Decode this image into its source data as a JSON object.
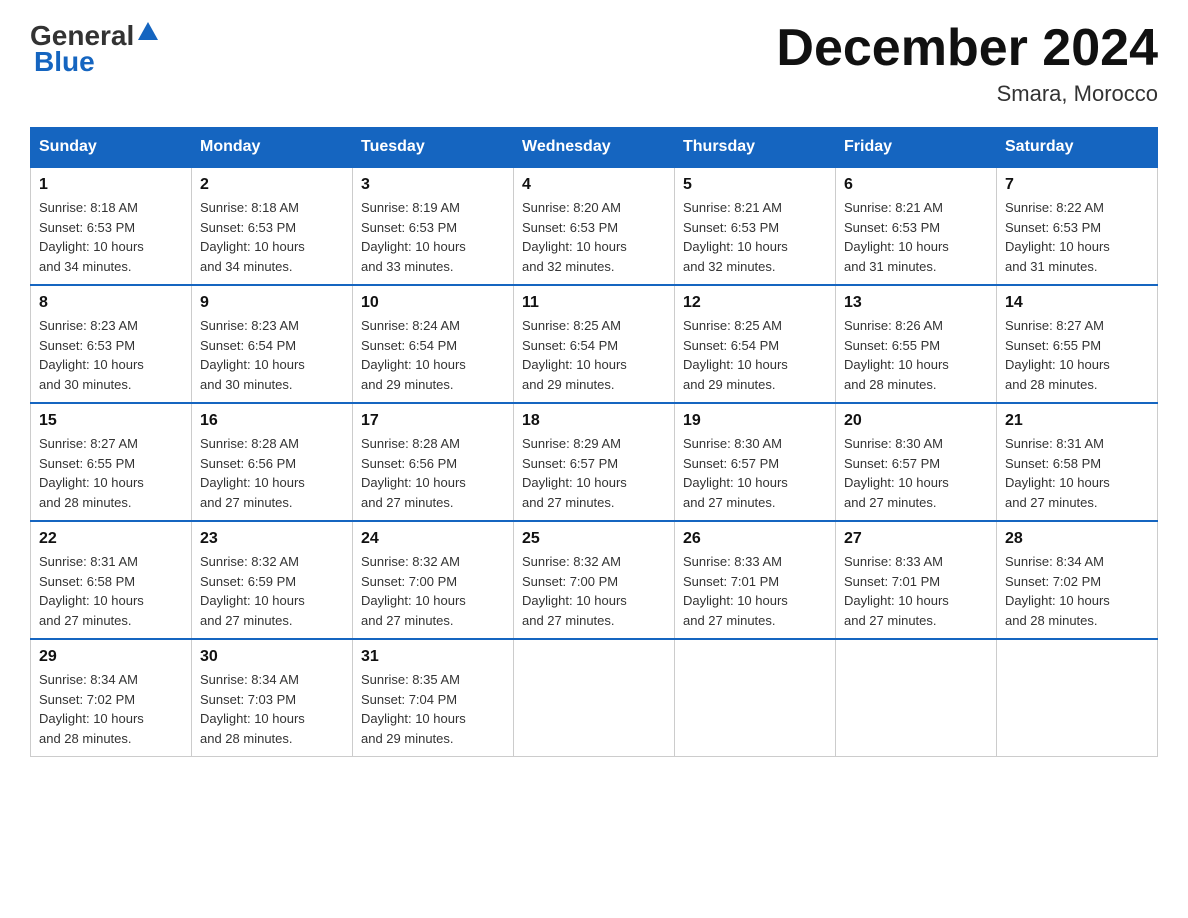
{
  "logo": {
    "text_general": "General",
    "text_blue": "Blue",
    "arrow": "▲"
  },
  "title": "December 2024",
  "subtitle": "Smara, Morocco",
  "calendar": {
    "headers": [
      "Sunday",
      "Monday",
      "Tuesday",
      "Wednesday",
      "Thursday",
      "Friday",
      "Saturday"
    ],
    "weeks": [
      [
        {
          "day": "1",
          "sunrise": "8:18 AM",
          "sunset": "6:53 PM",
          "daylight": "10 hours and 34 minutes."
        },
        {
          "day": "2",
          "sunrise": "8:18 AM",
          "sunset": "6:53 PM",
          "daylight": "10 hours and 34 minutes."
        },
        {
          "day": "3",
          "sunrise": "8:19 AM",
          "sunset": "6:53 PM",
          "daylight": "10 hours and 33 minutes."
        },
        {
          "day": "4",
          "sunrise": "8:20 AM",
          "sunset": "6:53 PM",
          "daylight": "10 hours and 32 minutes."
        },
        {
          "day": "5",
          "sunrise": "8:21 AM",
          "sunset": "6:53 PM",
          "daylight": "10 hours and 32 minutes."
        },
        {
          "day": "6",
          "sunrise": "8:21 AM",
          "sunset": "6:53 PM",
          "daylight": "10 hours and 31 minutes."
        },
        {
          "day": "7",
          "sunrise": "8:22 AM",
          "sunset": "6:53 PM",
          "daylight": "10 hours and 31 minutes."
        }
      ],
      [
        {
          "day": "8",
          "sunrise": "8:23 AM",
          "sunset": "6:53 PM",
          "daylight": "10 hours and 30 minutes."
        },
        {
          "day": "9",
          "sunrise": "8:23 AM",
          "sunset": "6:54 PM",
          "daylight": "10 hours and 30 minutes."
        },
        {
          "day": "10",
          "sunrise": "8:24 AM",
          "sunset": "6:54 PM",
          "daylight": "10 hours and 29 minutes."
        },
        {
          "day": "11",
          "sunrise": "8:25 AM",
          "sunset": "6:54 PM",
          "daylight": "10 hours and 29 minutes."
        },
        {
          "day": "12",
          "sunrise": "8:25 AM",
          "sunset": "6:54 PM",
          "daylight": "10 hours and 29 minutes."
        },
        {
          "day": "13",
          "sunrise": "8:26 AM",
          "sunset": "6:55 PM",
          "daylight": "10 hours and 28 minutes."
        },
        {
          "day": "14",
          "sunrise": "8:27 AM",
          "sunset": "6:55 PM",
          "daylight": "10 hours and 28 minutes."
        }
      ],
      [
        {
          "day": "15",
          "sunrise": "8:27 AM",
          "sunset": "6:55 PM",
          "daylight": "10 hours and 28 minutes."
        },
        {
          "day": "16",
          "sunrise": "8:28 AM",
          "sunset": "6:56 PM",
          "daylight": "10 hours and 27 minutes."
        },
        {
          "day": "17",
          "sunrise": "8:28 AM",
          "sunset": "6:56 PM",
          "daylight": "10 hours and 27 minutes."
        },
        {
          "day": "18",
          "sunrise": "8:29 AM",
          "sunset": "6:57 PM",
          "daylight": "10 hours and 27 minutes."
        },
        {
          "day": "19",
          "sunrise": "8:30 AM",
          "sunset": "6:57 PM",
          "daylight": "10 hours and 27 minutes."
        },
        {
          "day": "20",
          "sunrise": "8:30 AM",
          "sunset": "6:57 PM",
          "daylight": "10 hours and 27 minutes."
        },
        {
          "day": "21",
          "sunrise": "8:31 AM",
          "sunset": "6:58 PM",
          "daylight": "10 hours and 27 minutes."
        }
      ],
      [
        {
          "day": "22",
          "sunrise": "8:31 AM",
          "sunset": "6:58 PM",
          "daylight": "10 hours and 27 minutes."
        },
        {
          "day": "23",
          "sunrise": "8:32 AM",
          "sunset": "6:59 PM",
          "daylight": "10 hours and 27 minutes."
        },
        {
          "day": "24",
          "sunrise": "8:32 AM",
          "sunset": "7:00 PM",
          "daylight": "10 hours and 27 minutes."
        },
        {
          "day": "25",
          "sunrise": "8:32 AM",
          "sunset": "7:00 PM",
          "daylight": "10 hours and 27 minutes."
        },
        {
          "day": "26",
          "sunrise": "8:33 AM",
          "sunset": "7:01 PM",
          "daylight": "10 hours and 27 minutes."
        },
        {
          "day": "27",
          "sunrise": "8:33 AM",
          "sunset": "7:01 PM",
          "daylight": "10 hours and 27 minutes."
        },
        {
          "day": "28",
          "sunrise": "8:34 AM",
          "sunset": "7:02 PM",
          "daylight": "10 hours and 28 minutes."
        }
      ],
      [
        {
          "day": "29",
          "sunrise": "8:34 AM",
          "sunset": "7:02 PM",
          "daylight": "10 hours and 28 minutes."
        },
        {
          "day": "30",
          "sunrise": "8:34 AM",
          "sunset": "7:03 PM",
          "daylight": "10 hours and 28 minutes."
        },
        {
          "day": "31",
          "sunrise": "8:35 AM",
          "sunset": "7:04 PM",
          "daylight": "10 hours and 29 minutes."
        },
        null,
        null,
        null,
        null
      ]
    ],
    "labels": {
      "sunrise": "Sunrise:",
      "sunset": "Sunset:",
      "daylight": "Daylight:"
    }
  }
}
